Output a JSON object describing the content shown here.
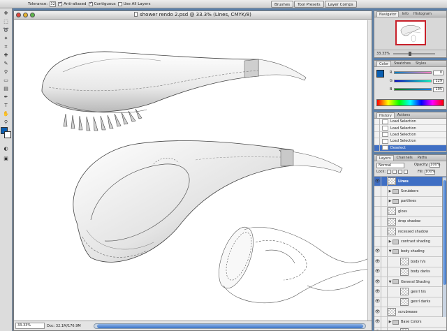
{
  "options_bar": {
    "tolerance_label": "Tolerance:",
    "tolerance_value": "32",
    "anti_aliased_label": "Anti-aliased",
    "anti_aliased_checked": true,
    "contiguous_label": "Contiguous",
    "contiguous_checked": true,
    "use_all_layers_label": "Use All Layers",
    "use_all_layers_checked": false
  },
  "palette_well": {
    "tabs": [
      "Brushes",
      "Tool Presets",
      "Layer Comps"
    ]
  },
  "document": {
    "title": "shower rendo 2.psd @ 33.3% (Lines, CMYK/8)",
    "zoom": "33.33%",
    "doc_size": "Doc: 32.1M/176.9M"
  },
  "navigator": {
    "tabs": [
      "Navigator",
      "Info",
      "Histogram"
    ],
    "zoom": "33.33%"
  },
  "color": {
    "tabs": [
      "Color",
      "Swatches",
      "Styles"
    ],
    "channels": [
      {
        "label": "R",
        "value": "0"
      },
      {
        "label": "G",
        "value": "129"
      },
      {
        "label": "B",
        "value": "195"
      }
    ],
    "foreground": "#0b5fb2",
    "background": "#ffffff"
  },
  "history": {
    "tabs": [
      "History",
      "Actions"
    ],
    "items": [
      {
        "label": "Load Selection",
        "selected": false
      },
      {
        "label": "Load Selection",
        "selected": false
      },
      {
        "label": "Load Selection",
        "selected": false
      },
      {
        "label": "Load Selection",
        "selected": false
      },
      {
        "label": "Deselect",
        "selected": true
      }
    ]
  },
  "layers": {
    "tabs": [
      "Layers",
      "Channels",
      "Paths"
    ],
    "blend_mode": "Normal",
    "opacity_label": "Opacity:",
    "opacity": "100%",
    "lock_label": "Lock:",
    "fill_label": "Fill:",
    "fill": "100%",
    "items": [
      {
        "name": "Lines",
        "kind": "layer",
        "level": 0,
        "selected": true,
        "visible": true
      },
      {
        "name": "Scrubbers",
        "kind": "group",
        "level": 0,
        "selected": false,
        "visible": false
      },
      {
        "name": "partlines",
        "kind": "group",
        "level": 0,
        "selected": false,
        "visible": false
      },
      {
        "name": "gloss",
        "kind": "layer",
        "level": 0,
        "selected": false,
        "visible": false
      },
      {
        "name": "drop shadow",
        "kind": "layer",
        "level": 0,
        "selected": false,
        "visible": false
      },
      {
        "name": "recessed shadow",
        "kind": "layer",
        "level": 0,
        "selected": false,
        "visible": false
      },
      {
        "name": "contrast shading",
        "kind": "group",
        "level": 0,
        "selected": false,
        "visible": false
      },
      {
        "name": "body shading",
        "kind": "group",
        "level": 0,
        "selected": false,
        "visible": true
      },
      {
        "name": "body h/s",
        "kind": "layer",
        "level": 1,
        "selected": false,
        "visible": true
      },
      {
        "name": "body darks",
        "kind": "layer",
        "level": 1,
        "selected": false,
        "visible": true
      },
      {
        "name": "General Shading",
        "kind": "group",
        "level": 0,
        "selected": false,
        "visible": true
      },
      {
        "name": "genrl h/s",
        "kind": "layer",
        "level": 1,
        "selected": false,
        "visible": true
      },
      {
        "name": "genrl darks",
        "kind": "layer",
        "level": 1,
        "selected": false,
        "visible": true
      },
      {
        "name": "scrubrease",
        "kind": "layer",
        "level": 0,
        "selected": false,
        "visible": true
      },
      {
        "name": "Base Colors",
        "kind": "group",
        "level": 0,
        "selected": false,
        "visible": true
      },
      {
        "name": "contrast fill",
        "kind": "layer",
        "level": 1,
        "selected": false,
        "visible": true
      }
    ]
  }
}
